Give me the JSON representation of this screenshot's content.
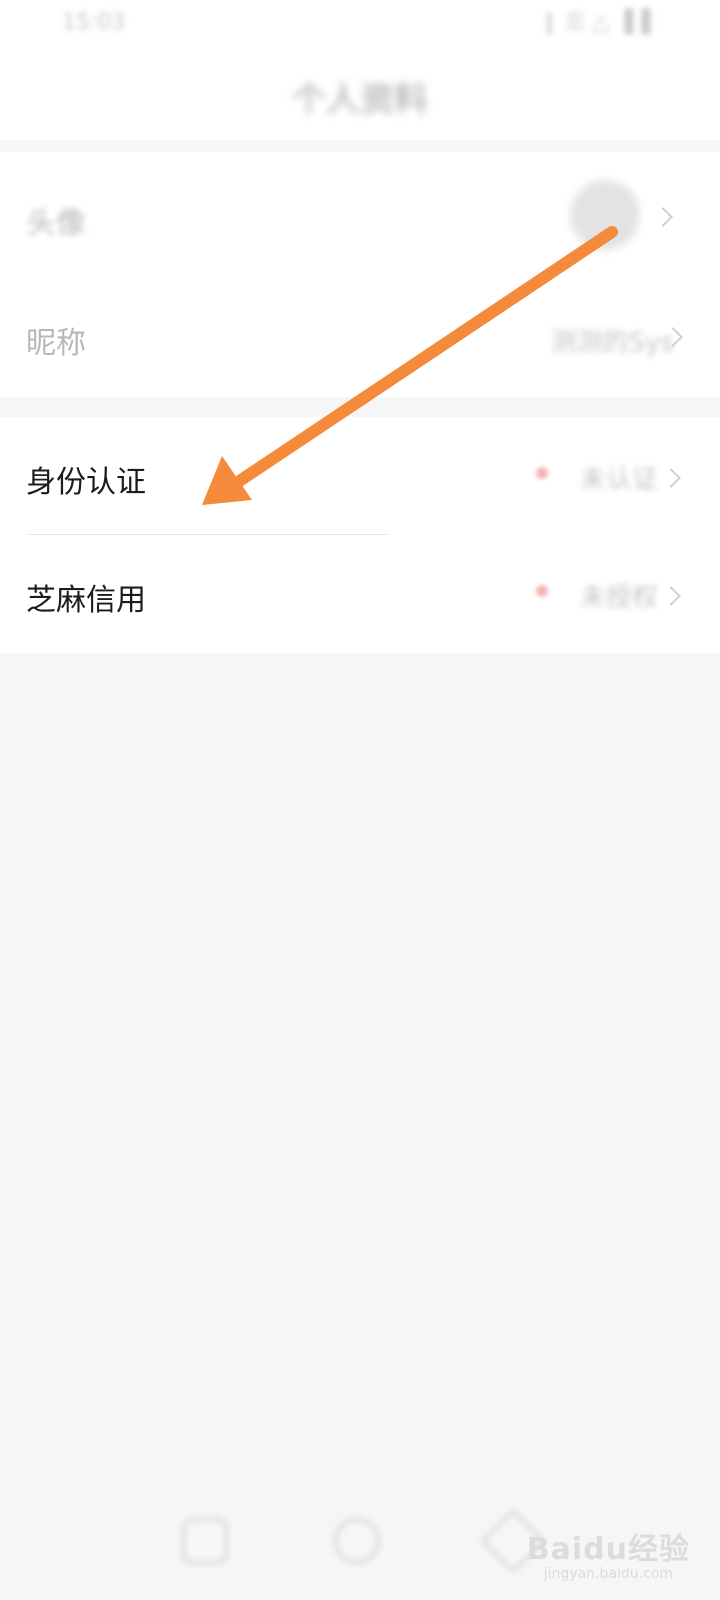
{
  "status_bar": {
    "time": "15:03",
    "icons_text": "❙ ☰ △ ▐▐"
  },
  "header": {
    "title": "个人资料"
  },
  "profile": {
    "avatar_label": "头像",
    "nickname_label": "昵称",
    "nickname_value": "测测的Sys"
  },
  "verification": {
    "identity_label": "身份认证",
    "identity_status": "未认证",
    "credit_label": "芝麻信用",
    "credit_status": "未授权"
  },
  "annotation": {
    "arrow_color": "#f58a3a"
  },
  "bottom_nav": {
    "icons": [
      "square-icon",
      "circle-icon",
      "back-icon"
    ]
  },
  "watermark": {
    "logo": "Baidu经验",
    "url": "jingyan.baidu.com"
  }
}
